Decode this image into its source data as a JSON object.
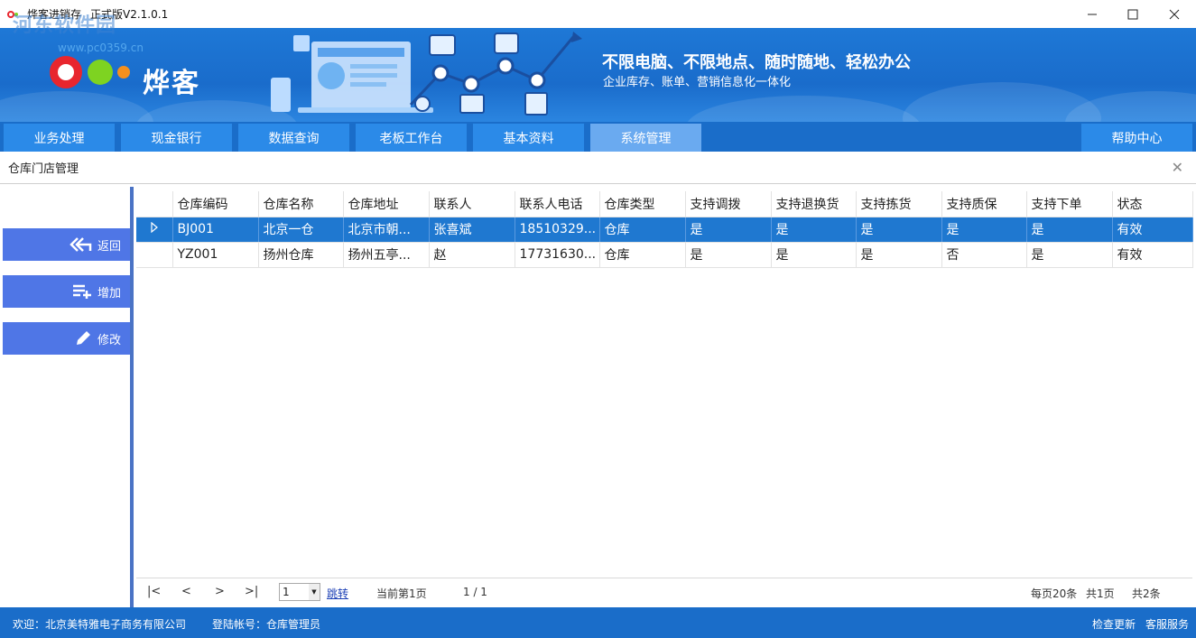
{
  "window": {
    "title": "烨客进销存",
    "version": "正式版V2.1.0.1",
    "watermark": "河东软件园",
    "watermark_url": "www.pc0359.cn"
  },
  "banner": {
    "logo_text": "烨客",
    "slogan": "不限电脑、不限地点、随时随地、轻松办公",
    "subslogan": "企业库存、账单、营销信息化一体化"
  },
  "nav": {
    "tabs": [
      "业务处理",
      "现金银行",
      "数据查询",
      "老板工作台",
      "基本资料",
      "系统管理"
    ],
    "active_tab": "系统管理",
    "help": "帮助中心"
  },
  "page": {
    "title": "仓库门店管理"
  },
  "sidebar": {
    "back": "返回",
    "add": "增加",
    "edit": "修改"
  },
  "table": {
    "columns": [
      "仓库编码",
      "仓库名称",
      "仓库地址",
      "联系人",
      "联系人电话",
      "仓库类型",
      "支持调拨",
      "支持退换货",
      "支持拣货",
      "支持质保",
      "支持下单",
      "状态"
    ],
    "rows": [
      [
        "BJ001",
        "北京一仓",
        "北京市朝...",
        "张喜斌",
        "18510329...",
        "仓库",
        "是",
        "是",
        "是",
        "是",
        "是",
        "有效"
      ],
      [
        "YZ001",
        "扬州仓库",
        "扬州五亭...",
        "赵",
        "17731630...",
        "仓库",
        "是",
        "是",
        "是",
        "否",
        "是",
        "有效"
      ]
    ],
    "selected_row": 0
  },
  "pager": {
    "first": "|<",
    "prev": "<",
    "next": ">",
    "last": ">|",
    "page_input": "1",
    "jump": "跳转",
    "current_page": "当前第1页",
    "page_of": "1 / 1",
    "per_page": "每页20条",
    "total_pages": "共1页",
    "total_items": "共2条"
  },
  "status": {
    "welcome": "欢迎：北京美特雅电子商务有限公司",
    "account": "登陆帐号：仓库管理员",
    "check_update": "检查更新",
    "service": "客服服务"
  },
  "colors": {
    "brand_blue": "#1a6dc9",
    "tab_blue": "#2b8ae8",
    "tab_active": "#6aaaf0",
    "side_button": "#4f76e6",
    "row_selected": "#1f78d0"
  }
}
